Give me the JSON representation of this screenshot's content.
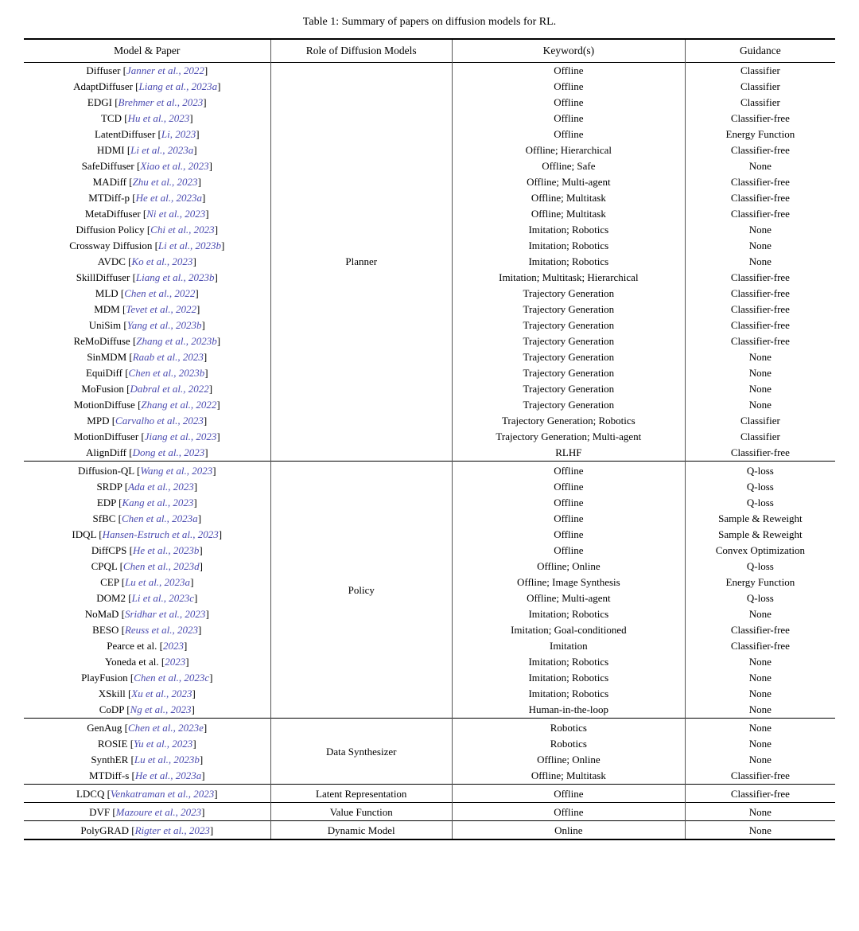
{
  "title": "Table 1: Summary of papers on diffusion models for RL.",
  "headers": [
    "Model & Paper",
    "Role of Diffusion Models",
    "Keyword(s)",
    "Guidance"
  ],
  "sections": [
    {
      "role": "Planner",
      "rows": [
        {
          "model": "Diffuser [Janner et al., 2022]",
          "keywords": "Offline",
          "guidance": "Classifier"
        },
        {
          "model": "AdaptDiffuser [Liang et al., 2023a]",
          "keywords": "Offline",
          "guidance": "Classifier"
        },
        {
          "model": "EDGI [Brehmer et al., 2023]",
          "keywords": "Offline",
          "guidance": "Classifier"
        },
        {
          "model": "TCD [Hu et al., 2023]",
          "keywords": "Offline",
          "guidance": "Classifier-free"
        },
        {
          "model": "LatentDiffuser [Li, 2023]",
          "keywords": "Offline",
          "guidance": "Energy Function"
        },
        {
          "model": "HDMI [Li et al., 2023a]",
          "keywords": "Offline; Hierarchical",
          "guidance": "Classifier-free"
        },
        {
          "model": "SafeDiffuser [Xiao et al., 2023]",
          "keywords": "Offline; Safe",
          "guidance": "None"
        },
        {
          "model": "MADiff [Zhu et al., 2023]",
          "keywords": "Offline; Multi-agent",
          "guidance": "Classifier-free"
        },
        {
          "model": "MTDiff-p [He et al., 2023a]",
          "keywords": "Offline; Multitask",
          "guidance": "Classifier-free"
        },
        {
          "model": "MetaDiffuser [Ni et al., 2023]",
          "keywords": "Offline; Multitask",
          "guidance": "Classifier-free"
        },
        {
          "model": "Diffusion Policy [Chi et al., 2023]",
          "keywords": "Imitation; Robotics",
          "guidance": "None"
        },
        {
          "model": "Crossway Diffusion [Li et al., 2023b]",
          "keywords": "Imitation; Robotics",
          "guidance": "None"
        },
        {
          "model": "AVDC [Ko et al., 2023]",
          "keywords": "Imitation; Robotics",
          "guidance": "None"
        },
        {
          "model": "SkillDiffuser [Liang et al., 2023b]",
          "keywords": "Imitation; Multitask; Hierarchical",
          "guidance": "Classifier-free"
        },
        {
          "model": "MLD [Chen et al., 2022]",
          "keywords": "Trajectory Generation",
          "guidance": "Classifier-free"
        },
        {
          "model": "MDM [Tevet et al., 2022]",
          "keywords": "Trajectory Generation",
          "guidance": "Classifier-free"
        },
        {
          "model": "UniSim [Yang et al., 2023b]",
          "keywords": "Trajectory Generation",
          "guidance": "Classifier-free"
        },
        {
          "model": "ReMoDiffuse [Zhang et al., 2023b]",
          "keywords": "Trajectory Generation",
          "guidance": "Classifier-free"
        },
        {
          "model": "SinMDM [Raab et al., 2023]",
          "keywords": "Trajectory Generation",
          "guidance": "None"
        },
        {
          "model": "EquiDiff [Chen et al., 2023b]",
          "keywords": "Trajectory Generation",
          "guidance": "None"
        },
        {
          "model": "MoFusion [Dabral et al., 2022]",
          "keywords": "Trajectory Generation",
          "guidance": "None"
        },
        {
          "model": "MotionDiffuse [Zhang et al., 2022]",
          "keywords": "Trajectory Generation",
          "guidance": "None"
        },
        {
          "model": "MPD [Carvalho et al., 2023]",
          "keywords": "Trajectory Generation; Robotics",
          "guidance": "Classifier"
        },
        {
          "model": "MotionDiffuser [Jiang et al., 2023]",
          "keywords": "Trajectory Generation; Multi-agent",
          "guidance": "Classifier"
        },
        {
          "model": "AlignDiff [Dong et al., 2023]",
          "keywords": "RLHF",
          "guidance": "Classifier-free"
        }
      ]
    },
    {
      "role": "Policy",
      "rows": [
        {
          "model": "Diffusion-QL [Wang et al., 2023]",
          "keywords": "Offline",
          "guidance": "Q-loss"
        },
        {
          "model": "SRDP [Ada et al., 2023]",
          "keywords": "Offline",
          "guidance": "Q-loss"
        },
        {
          "model": "EDP [Kang et al., 2023]",
          "keywords": "Offline",
          "guidance": "Q-loss"
        },
        {
          "model": "SfBC [Chen et al., 2023a]",
          "keywords": "Offline",
          "guidance": "Sample & Reweight"
        },
        {
          "model": "IDQL [Hansen-Estruch et al., 2023]",
          "keywords": "Offline",
          "guidance": "Sample & Reweight"
        },
        {
          "model": "DiffCPS [He et al., 2023b]",
          "keywords": "Offline",
          "guidance": "Convex Optimization"
        },
        {
          "model": "CPQL [Chen et al., 2023d]",
          "keywords": "Offline; Online",
          "guidance": "Q-loss"
        },
        {
          "model": "CEP [Lu et al., 2023a]",
          "keywords": "Offline; Image Synthesis",
          "guidance": "Energy Function"
        },
        {
          "model": "DOM2 [Li et al., 2023c]",
          "keywords": "Offline; Multi-agent",
          "guidance": "Q-loss"
        },
        {
          "model": "NoMaD [Sridhar et al., 2023]",
          "keywords": "Imitation; Robotics",
          "guidance": "None"
        },
        {
          "model": "BESO [Reuss et al., 2023]",
          "keywords": "Imitation; Goal-conditioned",
          "guidance": "Classifier-free"
        },
        {
          "model": "Pearce et al.  [2023]",
          "keywords": "Imitation",
          "guidance": "Classifier-free"
        },
        {
          "model": "Yoneda et al.  [2023]",
          "keywords": "Imitation; Robotics",
          "guidance": "None"
        },
        {
          "model": "PlayFusion [Chen et al., 2023c]",
          "keywords": "Imitation; Robotics",
          "guidance": "None"
        },
        {
          "model": "XSkill [Xu et al., 2023]",
          "keywords": "Imitation; Robotics",
          "guidance": "None"
        },
        {
          "model": "CoDP [Ng et al., 2023]",
          "keywords": "Human-in-the-loop",
          "guidance": "None"
        }
      ]
    },
    {
      "role": "Data Synthesizer",
      "rows": [
        {
          "model": "GenAug [Chen et al., 2023e]",
          "keywords": "Robotics",
          "guidance": "None"
        },
        {
          "model": "ROSIE [Yu et al., 2023]",
          "keywords": "Robotics",
          "guidance": "None"
        },
        {
          "model": "SynthER [Lu et al., 2023b]",
          "keywords": "Offline; Online",
          "guidance": "None"
        },
        {
          "model": "MTDiff-s [He et al., 2023a]",
          "keywords": "Offline; Multitask",
          "guidance": "Classifier-free"
        }
      ]
    },
    {
      "role": "Latent Representation",
      "rows": [
        {
          "model": "LDCQ [Venkatraman et al., 2023]",
          "keywords": "Offline",
          "guidance": "Classifier-free"
        }
      ]
    },
    {
      "role": "Value Function",
      "rows": [
        {
          "model": "DVF [Mazoure et al., 2023]",
          "keywords": "Offline",
          "guidance": "None"
        }
      ]
    },
    {
      "role": "Dynamic Model",
      "rows": [
        {
          "model": "PolyGRAD [Rigter et al., 2023]",
          "keywords": "Online",
          "guidance": "None"
        }
      ]
    }
  ]
}
